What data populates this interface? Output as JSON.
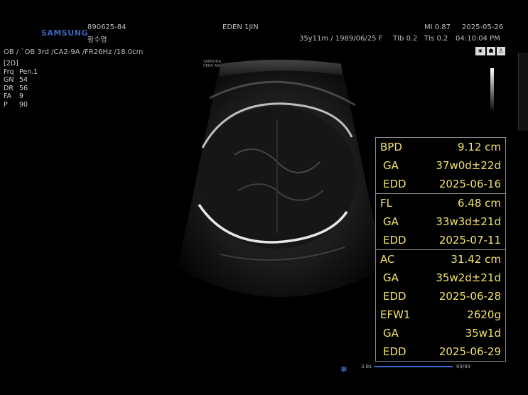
{
  "header": {
    "brand": "SAMSUNG",
    "patient_id": "890625-84",
    "patient_name": "황수영",
    "institution": "EDEN 1JIN",
    "patient_info": "35y11m / 1989/06/25 F",
    "mi": "MI  0.87",
    "date": "2025-05-26",
    "tib": "TIb 0.2",
    "tis": "TIs 0.2",
    "time": "04:10:04 PM",
    "probe_line": "OB / `OB 3rd /CA2-9A /FR26Hz /18.0cm"
  },
  "params": [
    {
      "k": "[2D]",
      "v": ""
    },
    {
      "k": "Frq",
      "v": "Pen.1"
    },
    {
      "k": "GN",
      "v": "54"
    },
    {
      "k": "DR",
      "v": "56"
    },
    {
      "k": "FA",
      "v": "9"
    },
    {
      "k": "P",
      "v": "90"
    }
  ],
  "watermark": "SAMSUNG HERA W9",
  "measurements": {
    "groups": [
      {
        "rows": [
          {
            "label": "BPD",
            "value": "9.12  cm"
          },
          {
            "label": "GA",
            "value": "37w0d±22d"
          },
          {
            "label": "EDD",
            "value": "2025-06-16"
          }
        ]
      },
      {
        "rows": [
          {
            "label": "FL",
            "value": "6.48  cm"
          },
          {
            "label": "GA",
            "value": "33w3d±21d"
          },
          {
            "label": "EDD",
            "value": "2025-07-11"
          }
        ]
      },
      {
        "rows": [
          {
            "label": "AC",
            "value": "31.42  cm"
          },
          {
            "label": "GA",
            "value": "35w2d±21d"
          },
          {
            "label": "EDD",
            "value": "2025-06-28"
          },
          {
            "label": "EFW1",
            "value": "2620g"
          },
          {
            "label": "GA",
            "value": "35w1d"
          },
          {
            "label": "EDD",
            "value": "2025-06-29"
          }
        ]
      }
    ]
  },
  "cine": {
    "time": "3.8s",
    "frame": "89/99"
  },
  "colors": {
    "measure_text": "#f0e36a",
    "brand": "#3d63b8",
    "cine_bar": "#3a6fd8"
  },
  "icons": [
    "snowflake-icon",
    "probe-icon",
    "body-marker-icon"
  ]
}
